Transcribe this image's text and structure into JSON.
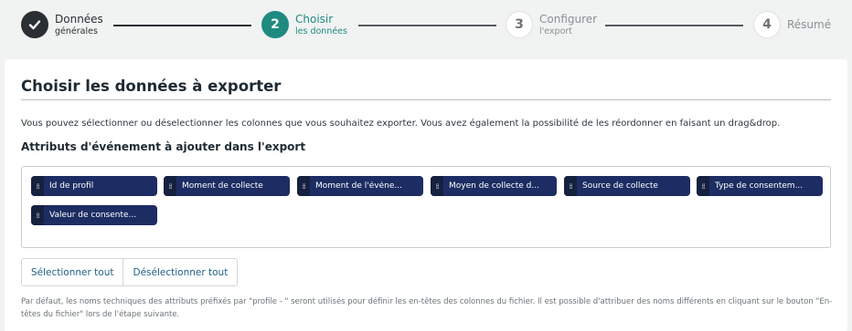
{
  "stepper": {
    "steps": [
      {
        "number": "",
        "title": "Données",
        "subtitle": "générales",
        "state": "done"
      },
      {
        "number": "2",
        "title": "Choisir",
        "subtitle": "les données",
        "state": "active"
      },
      {
        "number": "3",
        "title": "Configurer",
        "subtitle": "l'export",
        "state": "todo"
      },
      {
        "number": "4",
        "title": "Résumé",
        "subtitle": "",
        "state": "todo"
      }
    ]
  },
  "card": {
    "title": "Choisir les données à exporter",
    "description": "Vous pouvez sélectionner ou déselectionner les colonnes que vous souhaitez exporter. Vous avez également la possibilité de les réordonner en faisant un drag&drop.",
    "section_title": "Attributs d'événement à ajouter dans l'export",
    "chips": [
      "Id de profil",
      "Moment de collecte",
      "Moment de l'événe...",
      "Moyen de collecte d...",
      "Source de collecte",
      "Type de consentem...",
      "Valeur de consente..."
    ],
    "buttons": {
      "select_all": "Sélectionner tout",
      "deselect_all": "Désélectionner tout"
    },
    "note": "Par défaut, les noms techniques des attributs préfixés par \"profile - \" seront utilisés pour définir les en-têtes des colonnes du fichier. Il est possible d'attribuer des noms différents en cliquant sur le bouton \"En-têtes du fichier\" lors de l'étape suivante."
  },
  "colors": {
    "accent": "#1f8a80",
    "chip": "#1d2d63",
    "done": "#2a2f33"
  }
}
